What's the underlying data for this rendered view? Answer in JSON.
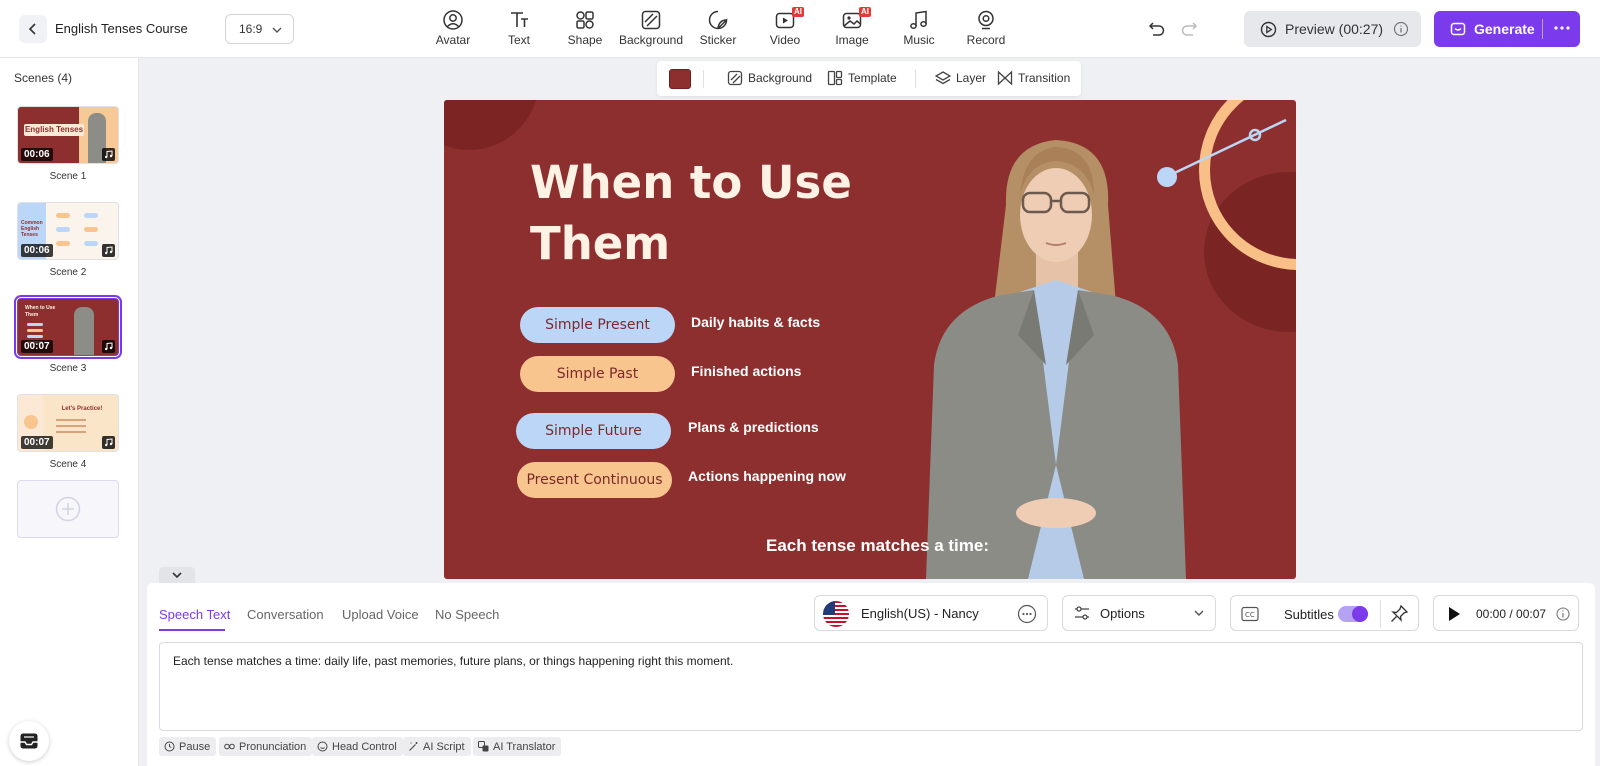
{
  "project": {
    "title": "English Tenses Course",
    "ratio": "16:9"
  },
  "toolbar": {
    "tools": [
      {
        "label": "Avatar",
        "icon": "avatar-icon"
      },
      {
        "label": "Text",
        "icon": "text-icon"
      },
      {
        "label": "Shape",
        "icon": "shape-icon"
      },
      {
        "label": "Background",
        "icon": "background-icon"
      },
      {
        "label": "Sticker",
        "icon": "sticker-icon"
      },
      {
        "label": "Video",
        "icon": "video-icon",
        "badge": "AI"
      },
      {
        "label": "Image",
        "icon": "image-icon",
        "badge": "AI"
      },
      {
        "label": "Music",
        "icon": "music-icon"
      },
      {
        "label": "Record",
        "icon": "record-icon"
      }
    ],
    "preview_label": "Preview (00:27)",
    "generate_label": "Generate"
  },
  "scenes": {
    "title": "Scenes (4)",
    "items": [
      {
        "label": "Scene 1",
        "duration": "00:06",
        "thumb_title": "English Tenses"
      },
      {
        "label": "Scene 2",
        "duration": "00:06",
        "thumb_title": "Common English Tenses"
      },
      {
        "label": "Scene 3",
        "duration": "00:07",
        "thumb_title": "When to Use Them",
        "active": true
      },
      {
        "label": "Scene 4",
        "duration": "00:07",
        "thumb_title": "Let's Practice!"
      }
    ]
  },
  "canvas_toolbar": {
    "swatch_color": "#8e2f2f",
    "background_label": "Background",
    "template_label": "Template",
    "layer_label": "Layer",
    "transition_label": "Transition"
  },
  "slide": {
    "bg_color": "#8e2f2f",
    "title": "When to Use Them",
    "rows": [
      {
        "pill": "Simple Present",
        "desc": "Daily habits & facts",
        "color": "blue"
      },
      {
        "pill": "Simple Past",
        "desc": "Finished actions",
        "color": "orange"
      },
      {
        "pill": "Simple Future",
        "desc": "Plans & predictions",
        "color": "blue"
      },
      {
        "pill": "Present Continuous",
        "desc": "Actions happening now",
        "color": "orange"
      }
    ],
    "subtitle": "Each tense matches a time:"
  },
  "speech": {
    "tabs": [
      "Speech Text",
      "Conversation",
      "Upload Voice",
      "No Speech"
    ],
    "active_tab": "Speech Text",
    "voice": "English(US) - Nancy",
    "options_label": "Options",
    "subtitles_label": "Subtitles",
    "subtitles_on": true,
    "time": "00:00 / 00:07",
    "script": "Each tense matches a time: daily life, past memories, future plans, or things happening right this moment.",
    "chips": [
      "Pause",
      "Pronunciation",
      "Head Control",
      "AI Script",
      "AI Translator"
    ]
  },
  "colors": {
    "accent": "#7c3aed",
    "pill_blue": "#bcd6f7",
    "pill_orange": "#f8c58f"
  }
}
